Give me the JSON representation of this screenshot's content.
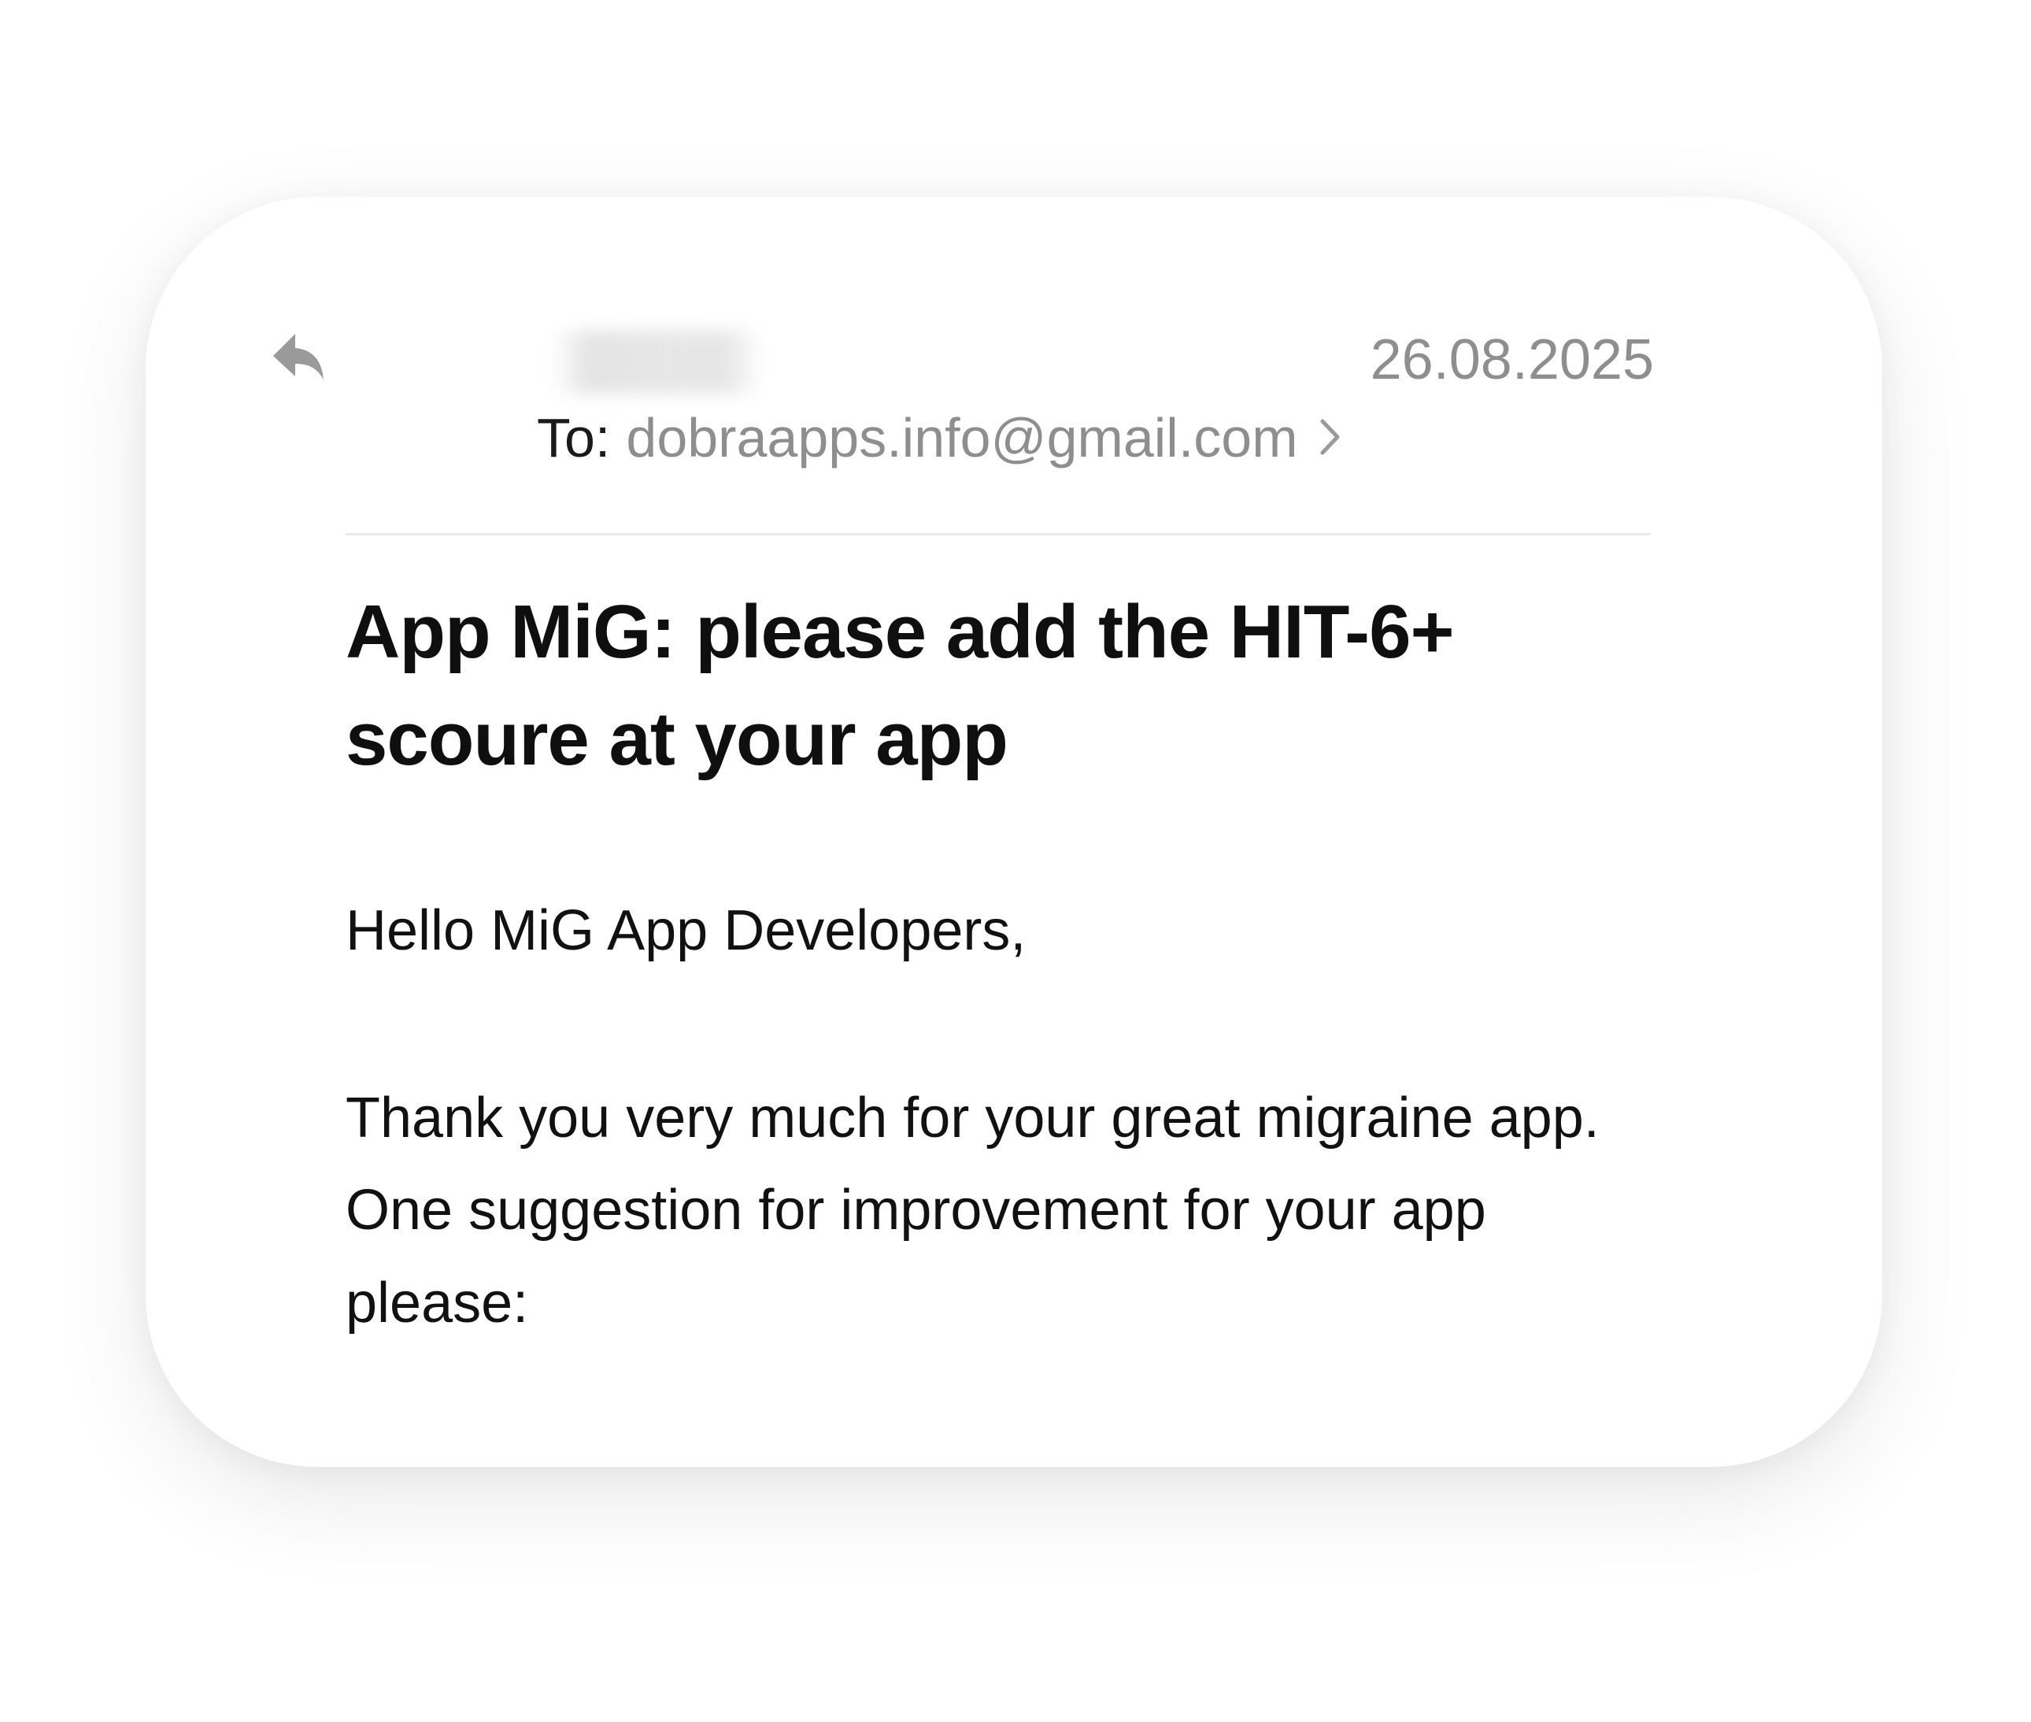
{
  "email": {
    "date": "26.08.2025",
    "to_label": "To:",
    "to_address": "dobraapps.info@gmail.com",
    "subject": "App MiG: please add the HIT-6+ scoure at your app",
    "greeting": "Hello MiG App Developers,",
    "body": "Thank you very much for your great migraine app. One suggestion for improvement for your app please:"
  },
  "icons": {
    "reply": "reply-icon",
    "chevron": "chevron-right-icon"
  },
  "colors": {
    "secondary_text": "#8e8e8e",
    "primary_text": "#111111",
    "divider": "#ececec"
  }
}
